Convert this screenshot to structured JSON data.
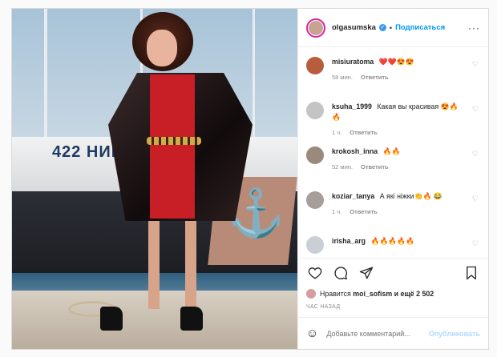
{
  "post": {
    "username": "olgasumska",
    "follow_label": "Подписаться",
    "photo": {
      "boat_number": "422 НИКА"
    }
  },
  "comments": [
    {
      "user": "misiuratoma",
      "text": "❤️❤️😍😍",
      "time": "58 мин.",
      "reply": "Ответить",
      "avatar_color": "#b85c3e"
    },
    {
      "user": "ksuha_1999",
      "text": "Какая вы красивая 😍🔥🔥",
      "time": "1 ч.",
      "reply": "Ответить",
      "avatar_color": "#c4c4c4"
    },
    {
      "user": "krokosh_inna",
      "text": "🔥🔥",
      "time": "52 мин.",
      "reply": "Ответить",
      "avatar_color": "#9a8a7a"
    },
    {
      "user": "koziar_tanya",
      "text": "А які ніжки👏🔥 😂",
      "time": "1 ч.",
      "reply": "Ответить",
      "avatar_color": "#a59e9b"
    },
    {
      "user": "irisha_arg",
      "text": "🔥🔥🔥🔥🔥",
      "time": "",
      "reply": "",
      "avatar_color": "#c9cfd4"
    }
  ],
  "likes": {
    "prefix": "Нравится",
    "user": "moi_sofism",
    "suffix": "и ещё 2 502"
  },
  "time_ago": "ЧАС НАЗАД",
  "add_comment": {
    "placeholder": "Добавьте комментарий...",
    "publish_label": "Опубликовать"
  },
  "colors": {
    "accent": "#0095f6",
    "verified": "#3897f0",
    "muted": "#8e8e8e"
  }
}
